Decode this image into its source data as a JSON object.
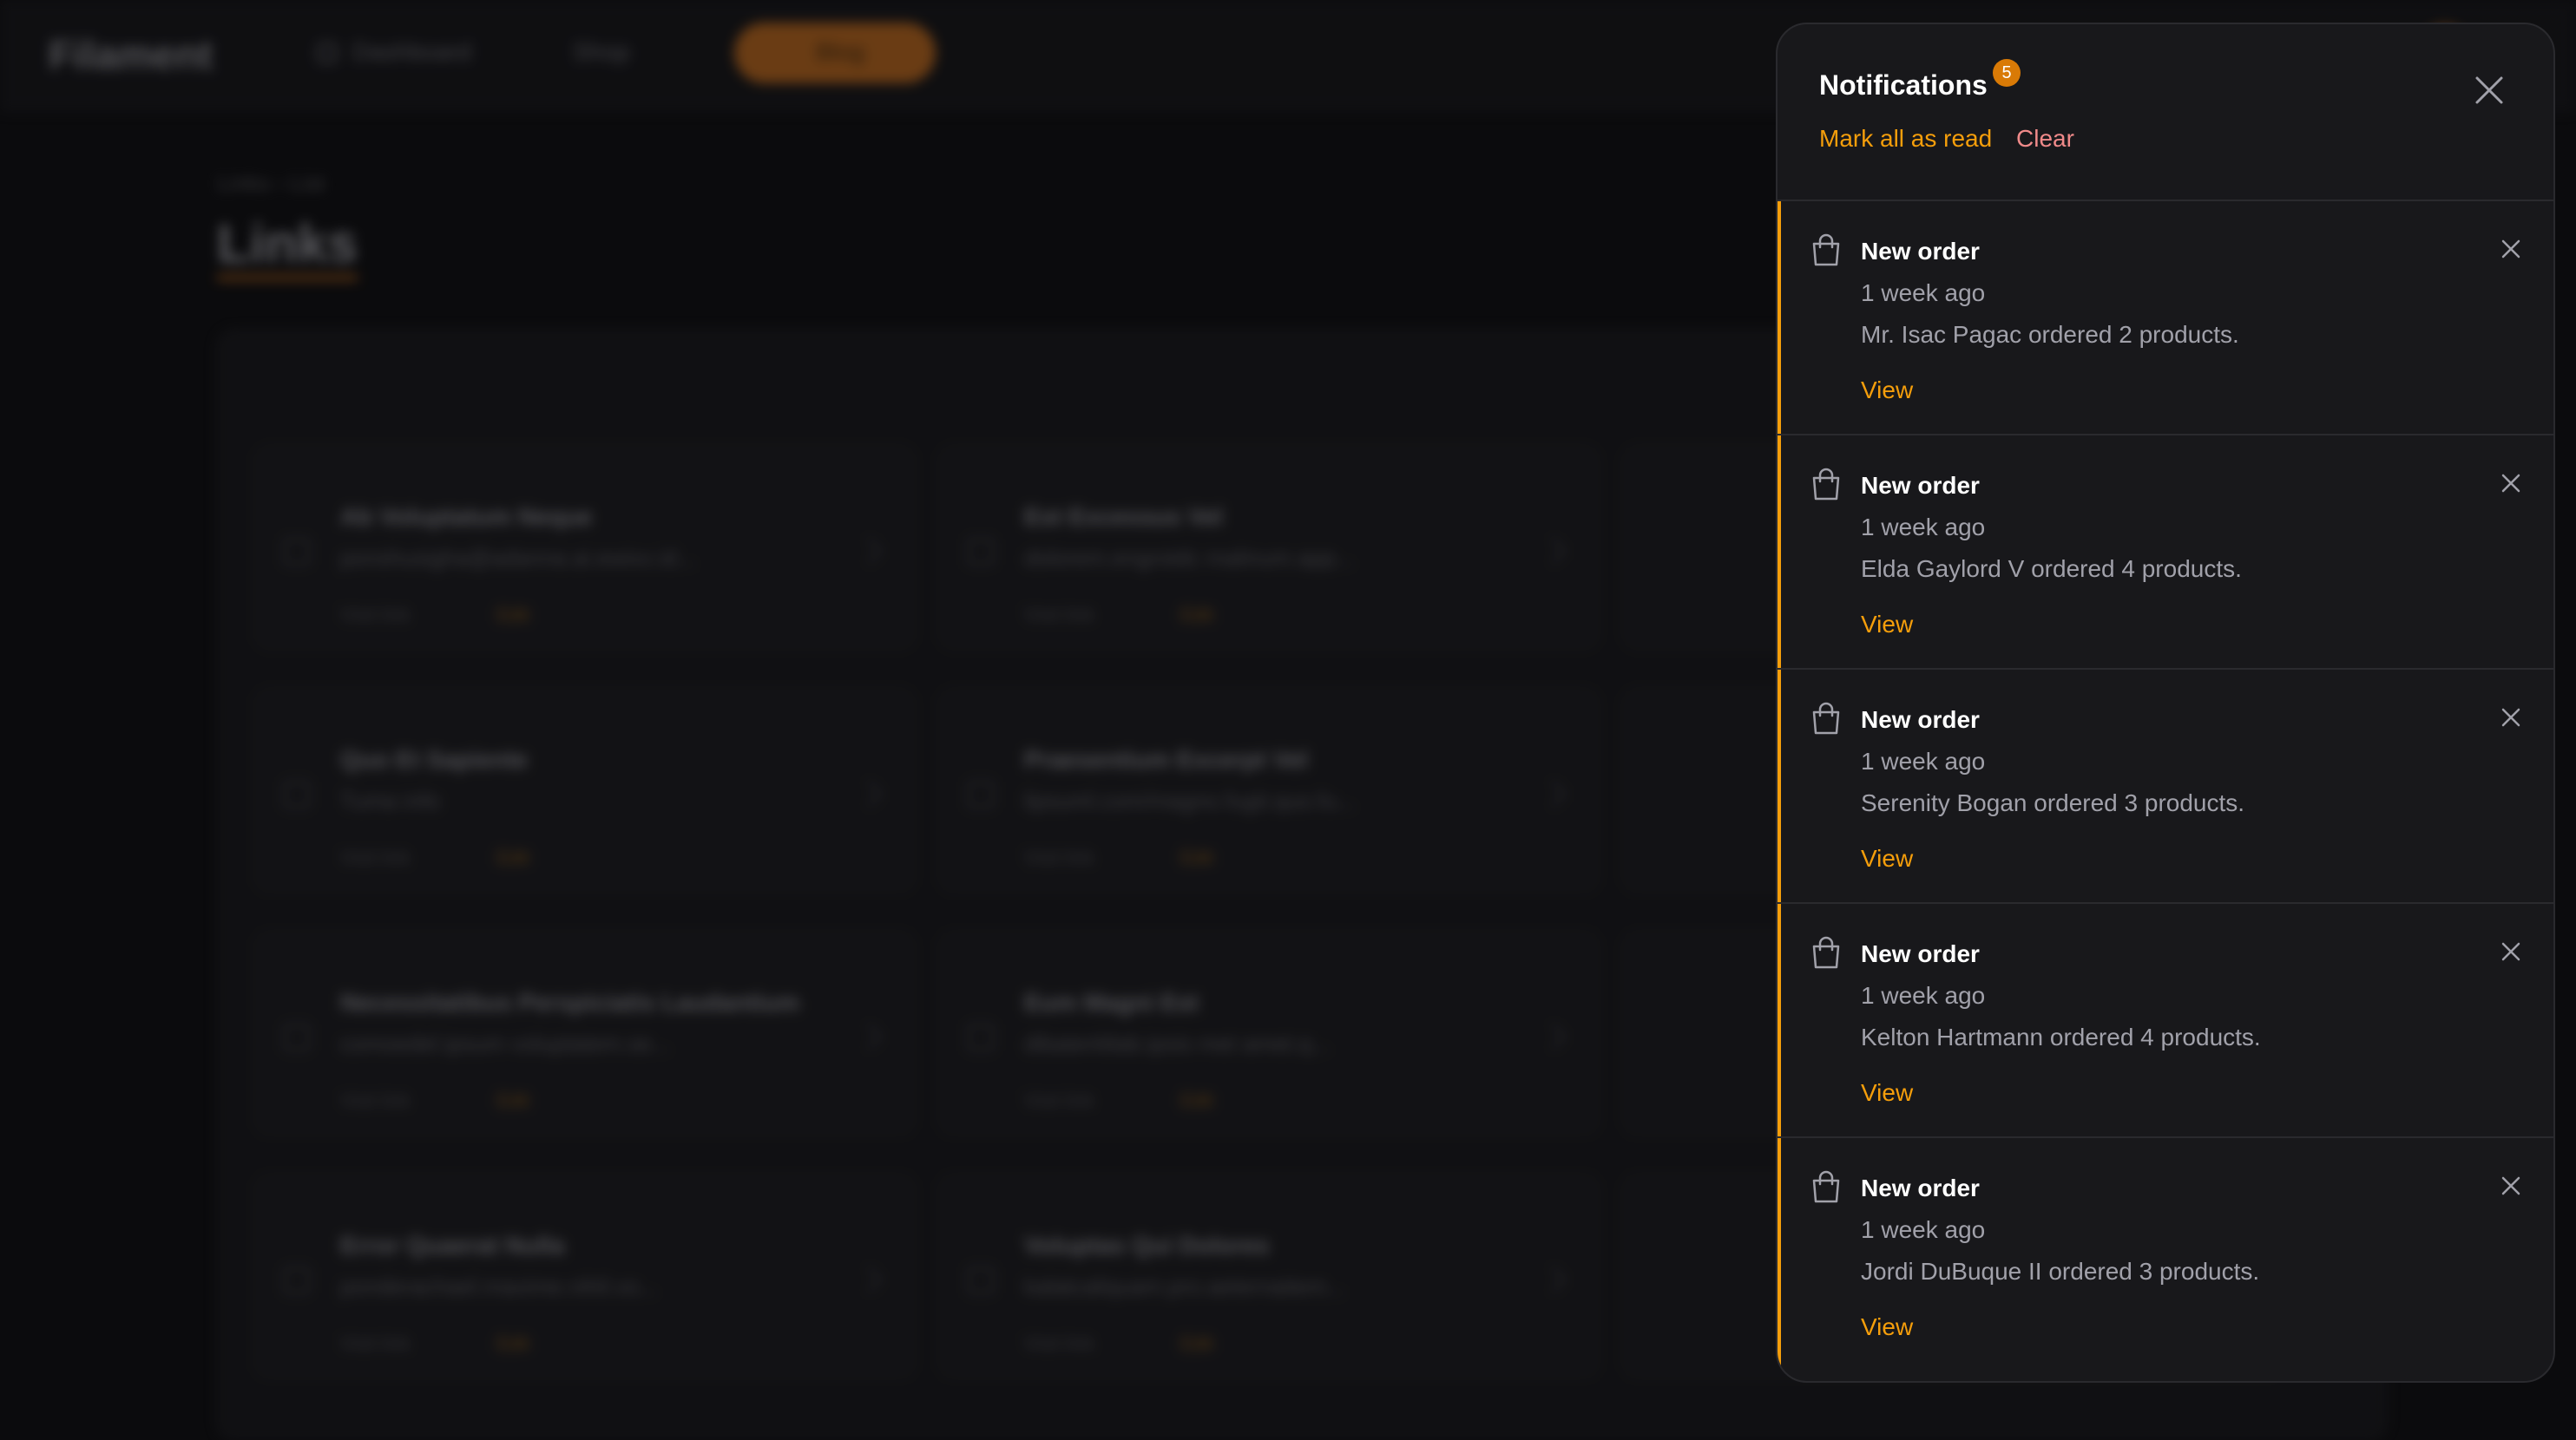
{
  "background": {
    "brand": "Filament",
    "nav": {
      "dashboard": "Dashboard",
      "shop": "Shop",
      "blog": "Blog"
    },
    "breadcrumb": "Links  ›  List",
    "page_title": "Links",
    "cards": [
      {
        "title": "Ab Voluptatum Neque",
        "subtitle": "ponshusigha@adanna.ai.ewixx.id...",
        "meta": "Visit link",
        "edit": "Edit"
      },
      {
        "title": "Est Excessus Vel",
        "subtitle": "dolorem.engrotdc malinum.app...",
        "meta": "Visit link",
        "edit": "Edit"
      },
      {
        "title": "Quo Et Sapiente",
        "subtitle": "Tuma info",
        "meta": "Visit link",
        "edit": "Edit"
      },
      {
        "title": "Praesentium Excerpt Vel",
        "subtitle": "lipsuml.com/magno.fugit.quo.fu...",
        "meta": "Visit link",
        "edit": "Edit"
      },
      {
        "title": "Necessitatibus Perspiciatis Laudantium",
        "subtitle": "comoedel.ipsum voluptatem.se...",
        "meta": "Visit link",
        "edit": "Edit"
      },
      {
        "title": "Eum Magni Est",
        "subtitle": "dibatertitlab.ipsis met amet.q...",
        "meta": "Visit link",
        "edit": "Edit"
      },
      {
        "title": "Error Quaerat Nulla",
        "subtitle": "ponderachael.maxime.nihil.vo...",
        "meta": "Visit link",
        "edit": "Edit"
      },
      {
        "title": "Voluptas Qui Dolores",
        "subtitle": "kalatcaliquam.pro.aeternaitem...",
        "meta": "Visit link",
        "edit": "Edit"
      }
    ]
  },
  "notifications": {
    "title": "Notifications",
    "count": "5",
    "mark_all_label": "Mark all as read",
    "clear_label": "Clear",
    "accent_color": "#f59e0b",
    "items": [
      {
        "icon": "shopping-bag-icon",
        "title": "New order",
        "time": "1 week ago",
        "body": "Mr. Isac Pagac ordered 2 products.",
        "action": "View",
        "unread": true
      },
      {
        "icon": "shopping-bag-icon",
        "title": "New order",
        "time": "1 week ago",
        "body": "Elda Gaylord V ordered 4 products.",
        "action": "View",
        "unread": true
      },
      {
        "icon": "shopping-bag-icon",
        "title": "New order",
        "time": "1 week ago",
        "body": "Serenity Bogan ordered 3 products.",
        "action": "View",
        "unread": true
      },
      {
        "icon": "shopping-bag-icon",
        "title": "New order",
        "time": "1 week ago",
        "body": "Kelton Hartmann ordered 4 products.",
        "action": "View",
        "unread": true
      },
      {
        "icon": "shopping-bag-icon",
        "title": "New order",
        "time": "1 week ago",
        "body": "Jordi DuBuque II ordered 3 products.",
        "action": "View",
        "unread": true
      }
    ]
  }
}
